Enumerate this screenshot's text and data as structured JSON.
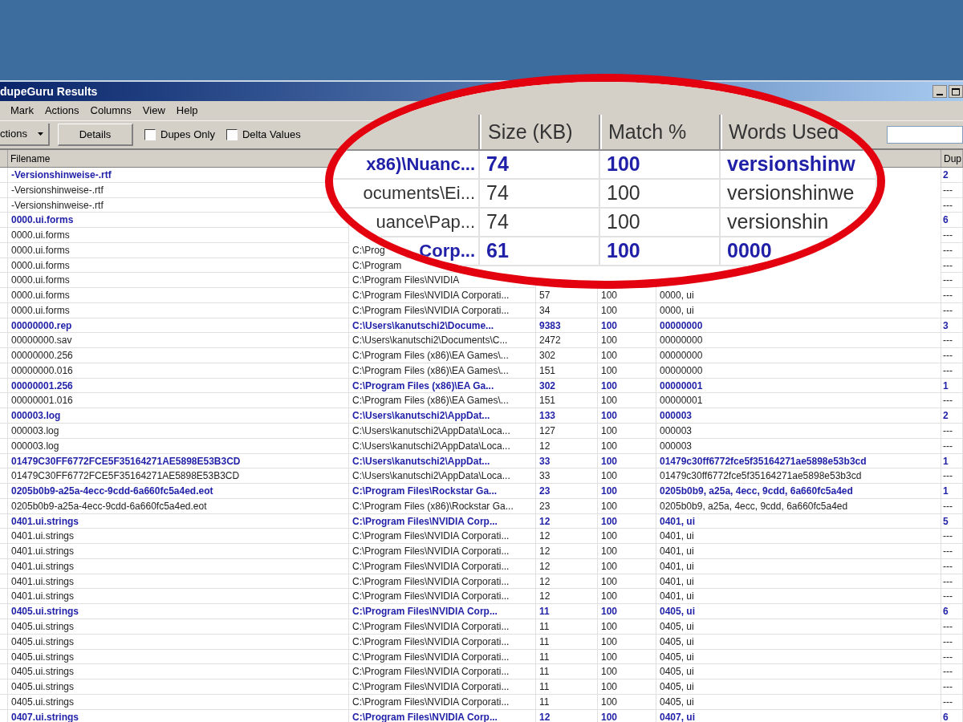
{
  "window": {
    "title": "dupeGuru Results"
  },
  "menu": [
    "Mark",
    "Actions",
    "Columns",
    "View",
    "Help"
  ],
  "toolbar": {
    "actions_dropdown": "ctions",
    "details_button": "Details",
    "checkboxes": [
      {
        "label": "Dupes Only",
        "checked": false
      },
      {
        "label": "Delta Values",
        "checked": false
      }
    ]
  },
  "table": {
    "header": {
      "filename": "Filename",
      "dupes": "Dup"
    },
    "rows": [
      {
        "kind": "group",
        "filename": "-Versionshinweise-.rtf",
        "dupes": "2"
      },
      {
        "kind": "dupe",
        "filename": "-Versionshinweise-.rtf",
        "dupes": "---"
      },
      {
        "kind": "dupe",
        "filename": "-Versionshinweise-.rtf",
        "dupes": "---"
      },
      {
        "kind": "group",
        "filename": "0000.ui.forms",
        "dupes": "6"
      },
      {
        "kind": "dupe",
        "filename": "0000.ui.forms",
        "dupes": "---"
      },
      {
        "kind": "dupe",
        "filename": "0000.ui.forms",
        "folder": "C:\\Prog",
        "dupes": "---"
      },
      {
        "kind": "dupe",
        "filename": "0000.ui.forms",
        "folder": "C:\\Program",
        "dupes": "---"
      },
      {
        "kind": "dupe",
        "filename": "0000.ui.forms",
        "folder": "C:\\Program Files\\NVIDIA",
        "dupes": "---"
      },
      {
        "kind": "dupe",
        "filename": "0000.ui.forms",
        "folder": "C:\\Program Files\\NVIDIA Corporati...",
        "size": "57",
        "match": "100",
        "words": "0000, ui",
        "dupes": "---"
      },
      {
        "kind": "dupe",
        "filename": "0000.ui.forms",
        "folder": "C:\\Program Files\\NVIDIA Corporati...",
        "size": "34",
        "match": "100",
        "words": "0000, ui",
        "dupes": "---"
      },
      {
        "kind": "group",
        "filename": "00000000.rep",
        "folder": "C:\\Users\\kanutschi2\\Docume...",
        "size": "9383",
        "match": "100",
        "words": "00000000",
        "dupes": "3"
      },
      {
        "kind": "dupe",
        "filename": "00000000.sav",
        "folder": "C:\\Users\\kanutschi2\\Documents\\C...",
        "size": "2472",
        "match": "100",
        "words": "00000000",
        "dupes": "---"
      },
      {
        "kind": "dupe",
        "filename": "00000000.256",
        "folder": "C:\\Program Files (x86)\\EA Games\\...",
        "size": "302",
        "match": "100",
        "words": "00000000",
        "dupes": "---"
      },
      {
        "kind": "dupe",
        "filename": "00000000.016",
        "folder": "C:\\Program Files (x86)\\EA Games\\...",
        "size": "151",
        "match": "100",
        "words": "00000000",
        "dupes": "---"
      },
      {
        "kind": "group",
        "filename": "00000001.256",
        "folder": "C:\\Program Files (x86)\\EA Ga...",
        "size": "302",
        "match": "100",
        "words": "00000001",
        "dupes": "1"
      },
      {
        "kind": "dupe",
        "filename": "00000001.016",
        "folder": "C:\\Program Files (x86)\\EA Games\\...",
        "size": "151",
        "match": "100",
        "words": "00000001",
        "dupes": "---"
      },
      {
        "kind": "group",
        "filename": "000003.log",
        "folder": "C:\\Users\\kanutschi2\\AppDat...",
        "size": "133",
        "match": "100",
        "words": "000003",
        "dupes": "2"
      },
      {
        "kind": "dupe",
        "filename": "000003.log",
        "folder": "C:\\Users\\kanutschi2\\AppData\\Loca...",
        "size": "127",
        "match": "100",
        "words": "000003",
        "dupes": "---"
      },
      {
        "kind": "dupe",
        "filename": "000003.log",
        "folder": "C:\\Users\\kanutschi2\\AppData\\Loca...",
        "size": "12",
        "match": "100",
        "words": "000003",
        "dupes": "---"
      },
      {
        "kind": "group",
        "filename": "01479C30FF6772FCE5F35164271AE5898E53B3CD",
        "folder": "C:\\Users\\kanutschi2\\AppDat...",
        "size": "33",
        "match": "100",
        "words": "01479c30ff6772fce5f35164271ae5898e53b3cd",
        "dupes": "1"
      },
      {
        "kind": "dupe",
        "filename": "01479C30FF6772FCE5F35164271AE5898E53B3CD",
        "folder": "C:\\Users\\kanutschi2\\AppData\\Loca...",
        "size": "33",
        "match": "100",
        "words": "01479c30ff6772fce5f35164271ae5898e53b3cd",
        "dupes": "---"
      },
      {
        "kind": "group",
        "filename": "0205b0b9-a25a-4ecc-9cdd-6a660fc5a4ed.eot",
        "folder": "C:\\Program Files\\Rockstar Ga...",
        "size": "23",
        "match": "100",
        "words": "0205b0b9, a25a, 4ecc, 9cdd, 6a660fc5a4ed",
        "dupes": "1"
      },
      {
        "kind": "dupe",
        "filename": "0205b0b9-a25a-4ecc-9cdd-6a660fc5a4ed.eot",
        "folder": "C:\\Program Files (x86)\\Rockstar Ga...",
        "size": "23",
        "match": "100",
        "words": "0205b0b9, a25a, 4ecc, 9cdd, 6a660fc5a4ed",
        "dupes": "---"
      },
      {
        "kind": "group",
        "filename": "0401.ui.strings",
        "folder": "C:\\Program Files\\NVIDIA Corp...",
        "size": "12",
        "match": "100",
        "words": "0401, ui",
        "dupes": "5"
      },
      {
        "kind": "dupe",
        "filename": "0401.ui.strings",
        "folder": "C:\\Program Files\\NVIDIA Corporati...",
        "size": "12",
        "match": "100",
        "words": "0401, ui",
        "dupes": "---"
      },
      {
        "kind": "dupe",
        "filename": "0401.ui.strings",
        "folder": "C:\\Program Files\\NVIDIA Corporati...",
        "size": "12",
        "match": "100",
        "words": "0401, ui",
        "dupes": "---"
      },
      {
        "kind": "dupe",
        "filename": "0401.ui.strings",
        "folder": "C:\\Program Files\\NVIDIA Corporati...",
        "size": "12",
        "match": "100",
        "words": "0401, ui",
        "dupes": "---"
      },
      {
        "kind": "dupe",
        "filename": "0401.ui.strings",
        "folder": "C:\\Program Files\\NVIDIA Corporati...",
        "size": "12",
        "match": "100",
        "words": "0401, ui",
        "dupes": "---"
      },
      {
        "kind": "dupe",
        "filename": "0401.ui.strings",
        "folder": "C:\\Program Files\\NVIDIA Corporati...",
        "size": "12",
        "match": "100",
        "words": "0401, ui",
        "dupes": "---"
      },
      {
        "kind": "group",
        "filename": "0405.ui.strings",
        "folder": "C:\\Program Files\\NVIDIA Corp...",
        "size": "11",
        "match": "100",
        "words": "0405, ui",
        "dupes": "6"
      },
      {
        "kind": "dupe",
        "filename": "0405.ui.strings",
        "folder": "C:\\Program Files\\NVIDIA Corporati...",
        "size": "11",
        "match": "100",
        "words": "0405, ui",
        "dupes": "---"
      },
      {
        "kind": "dupe",
        "filename": "0405.ui.strings",
        "folder": "C:\\Program Files\\NVIDIA Corporati...",
        "size": "11",
        "match": "100",
        "words": "0405, ui",
        "dupes": "---"
      },
      {
        "kind": "dupe",
        "filename": "0405.ui.strings",
        "folder": "C:\\Program Files\\NVIDIA Corporati...",
        "size": "11",
        "match": "100",
        "words": "0405, ui",
        "dupes": "---"
      },
      {
        "kind": "dupe",
        "filename": "0405.ui.strings",
        "folder": "C:\\Program Files\\NVIDIA Corporati...",
        "size": "11",
        "match": "100",
        "words": "0405, ui",
        "dupes": "---"
      },
      {
        "kind": "dupe",
        "filename": "0405.ui.strings",
        "folder": "C:\\Program Files\\NVIDIA Corporati...",
        "size": "11",
        "match": "100",
        "words": "0405, ui",
        "dupes": "---"
      },
      {
        "kind": "dupe",
        "filename": "0405.ui.strings",
        "folder": "C:\\Program Files\\NVIDIA Corporati...",
        "size": "11",
        "match": "100",
        "words": "0405, ui",
        "dupes": "---"
      },
      {
        "kind": "group",
        "filename": "0407.ui.strings",
        "folder": "C:\\Program Files\\NVIDIA Corp...",
        "size": "12",
        "match": "100",
        "words": "0407, ui",
        "dupes": "6"
      }
    ]
  },
  "magnifier": {
    "header": [
      "Size (KB)",
      "Match %",
      "Words Used"
    ],
    "rows": [
      {
        "kind": "group",
        "folder": "x86)\\Nuanc...",
        "size": "74",
        "match": "100",
        "words": "versionshinw"
      },
      {
        "kind": "dupe",
        "folder": "ocuments\\Ei...",
        "size": "74",
        "match": "100",
        "words": "versionshinwe"
      },
      {
        "kind": "dupe",
        "folder": "uance\\Pap...",
        "size": "74",
        "match": "100",
        "words": "versionshin"
      },
      {
        "kind": "group",
        "folder": "Corp...",
        "size": "61",
        "match": "100",
        "words": "0000"
      }
    ]
  }
}
